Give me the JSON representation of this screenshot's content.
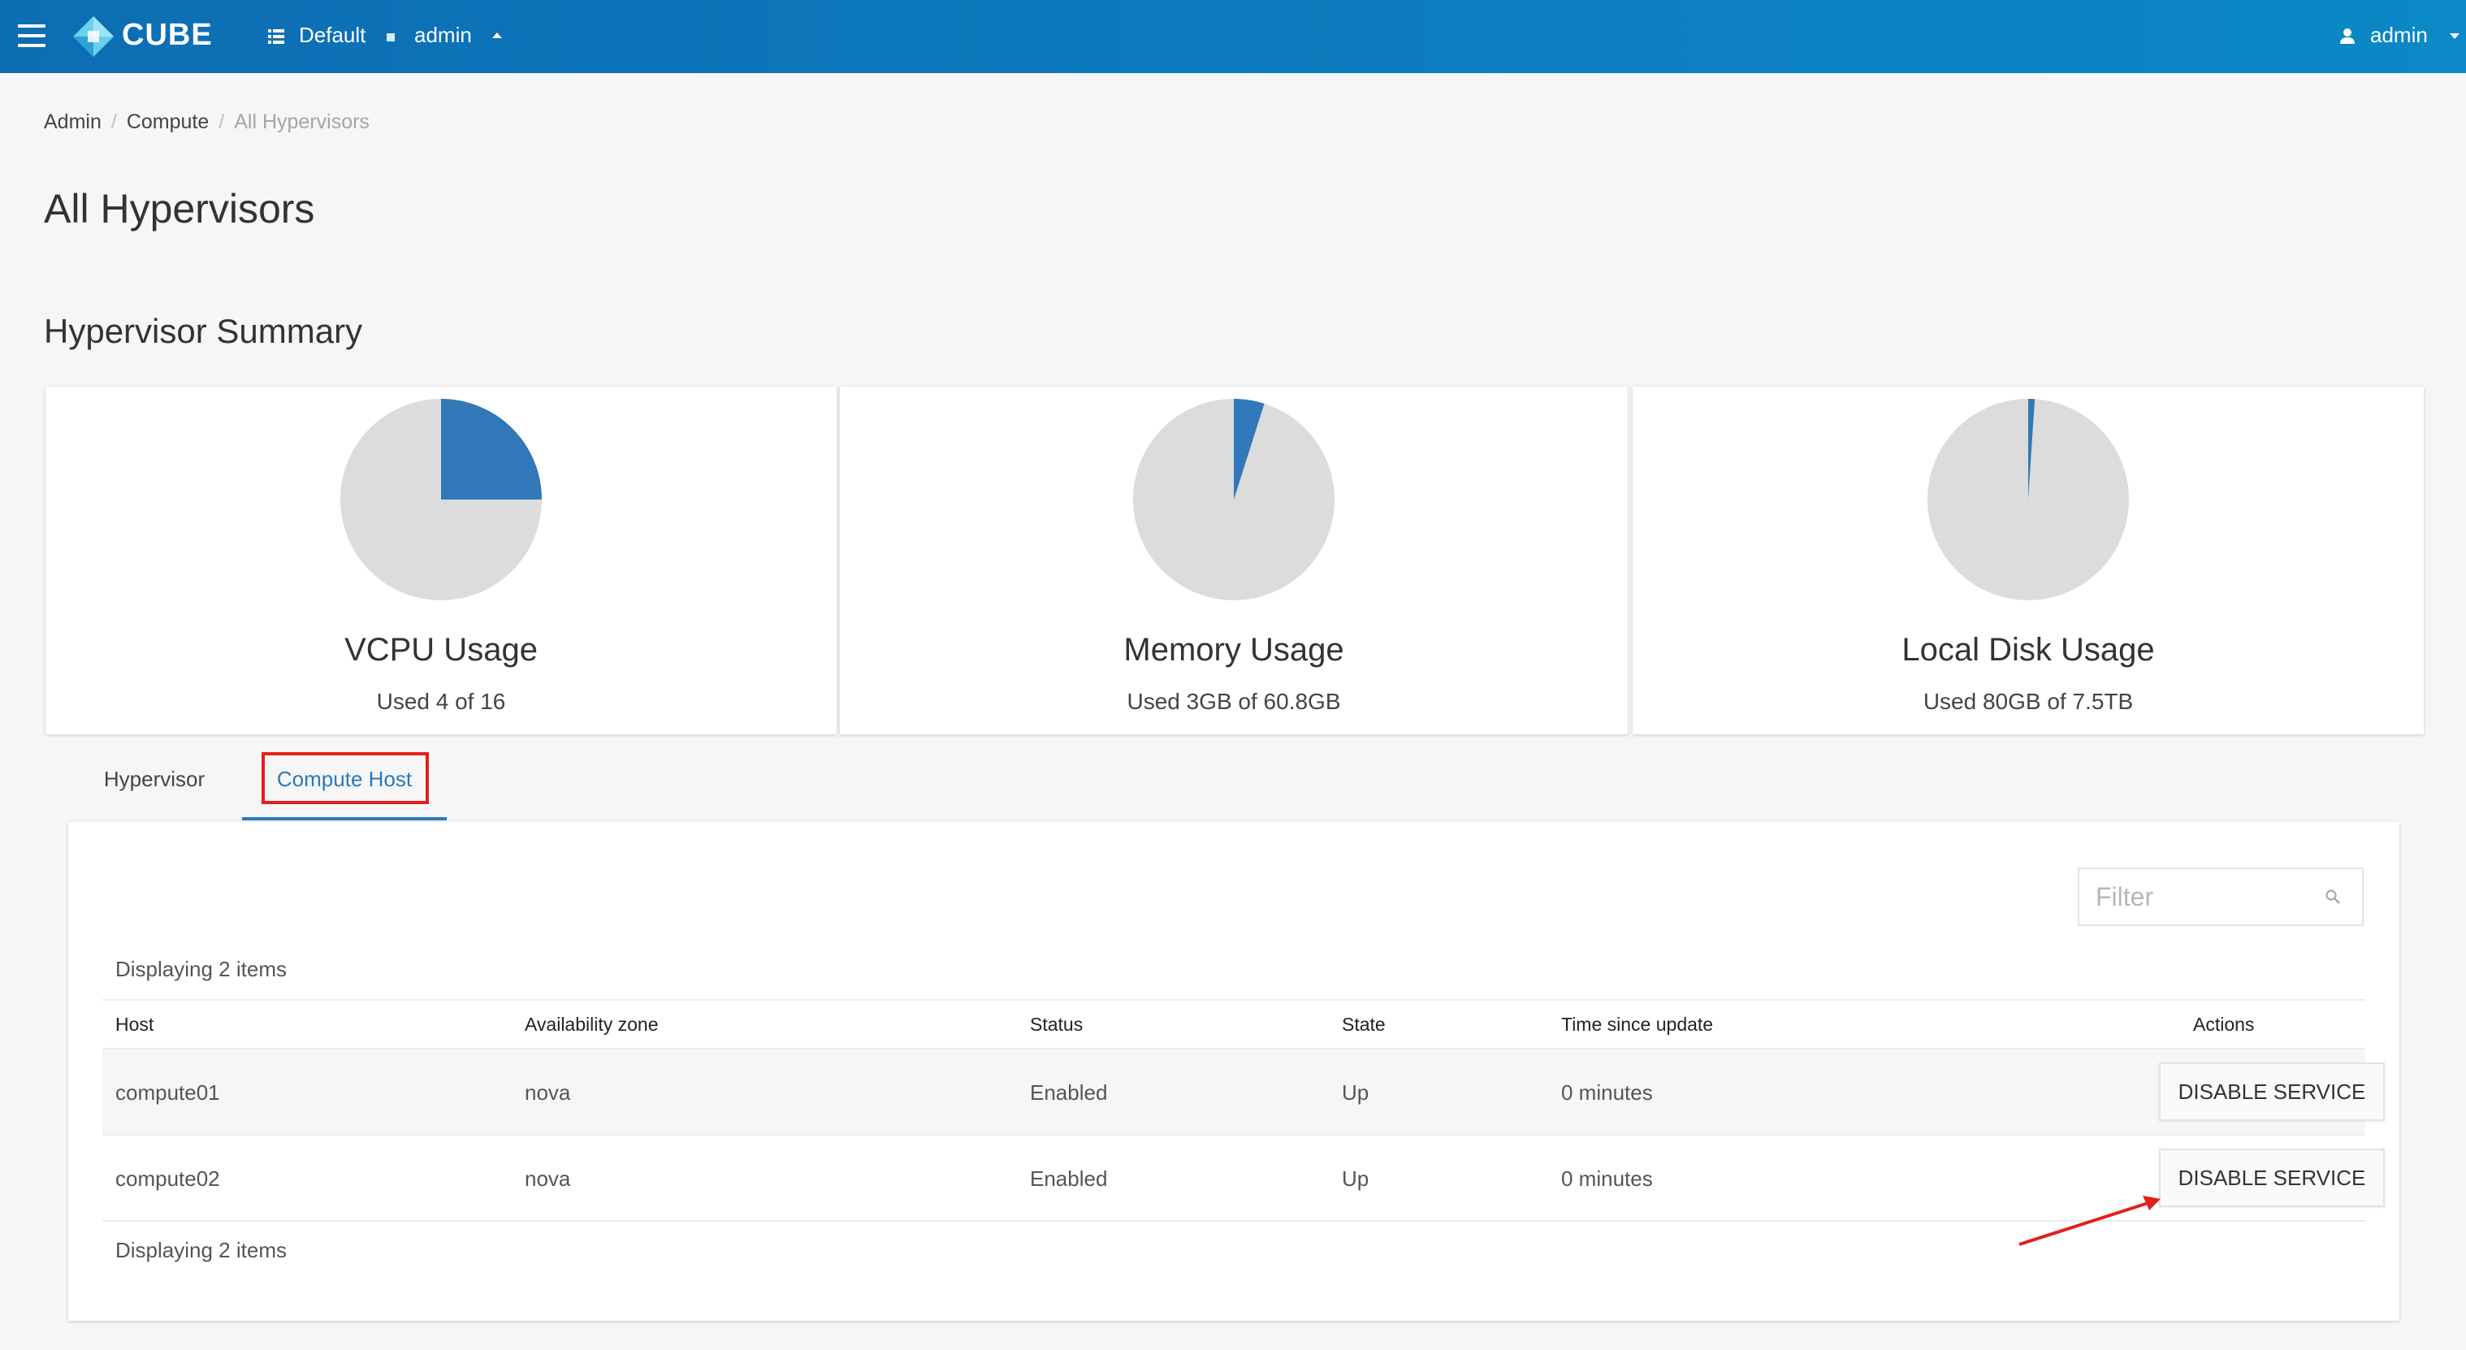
{
  "header": {
    "brand": "CUBE",
    "project": "Default",
    "user_in_project": "admin",
    "user": "admin",
    "brand_color": "#0d6db3"
  },
  "breadcrumb": [
    "Admin",
    "Compute",
    "All Hypervisors"
  ],
  "page_title": "All Hypervisors",
  "summary": {
    "title": "Hypervisor Summary",
    "cards": [
      {
        "title": "VCPU Usage",
        "subtitle": "Used 4 of 16",
        "fraction": 0.25
      },
      {
        "title": "Memory Usage",
        "subtitle": "Used 3GB of 60.8GB",
        "fraction": 0.049
      },
      {
        "title": "Local Disk Usage",
        "subtitle": "Used 80GB of 7.5TB",
        "fraction": 0.0104
      }
    ],
    "used_color": "#3179b8",
    "free_color": "#dcdcdc"
  },
  "tabs": [
    "Hypervisor",
    "Compute Host"
  ],
  "table": {
    "filter_placeholder": "Filter",
    "count_text": "Displaying 2 items",
    "columns": [
      "Host",
      "Availability zone",
      "Status",
      "State",
      "Time since update",
      "Actions"
    ],
    "rows": [
      {
        "host": "compute01",
        "zone": "nova",
        "status": "Enabled",
        "state": "Up",
        "time": "0 minutes",
        "action": "DISABLE SERVICE"
      },
      {
        "host": "compute02",
        "zone": "nova",
        "status": "Enabled",
        "state": "Up",
        "time": "0 minutes",
        "action": "DISABLE SERVICE"
      }
    ]
  },
  "annotation_color": "#e2201c"
}
